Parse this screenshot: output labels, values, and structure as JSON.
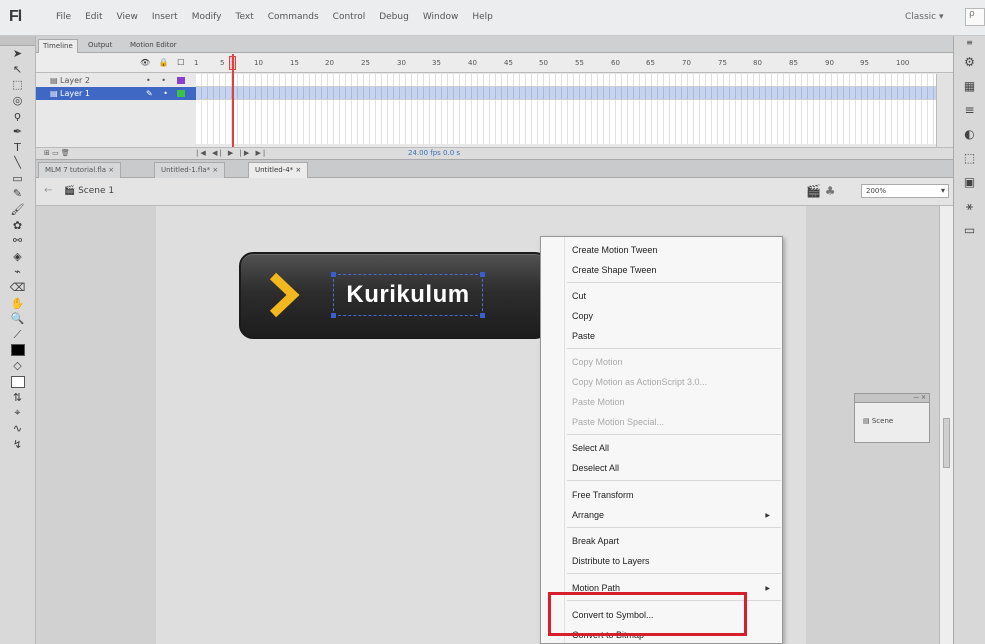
{
  "app": {
    "logo": "Fl",
    "menu": [
      "File",
      "Edit",
      "View",
      "Insert",
      "Modify",
      "Text",
      "Commands",
      "Control",
      "Debug",
      "Window",
      "Help"
    ],
    "workspace": "Classic",
    "search_placeholder": "ρ"
  },
  "timeline": {
    "tabs": [
      "Timeline",
      "Output",
      "Motion Editor"
    ],
    "header_icons": "👁 🔒 ☐",
    "ruler": [
      "1",
      "5",
      "10",
      "15",
      "20",
      "25",
      "30",
      "35",
      "40",
      "45",
      "50",
      "55",
      "60",
      "65",
      "70",
      "75",
      "80",
      "85",
      "90",
      "95",
      "100"
    ],
    "layers": [
      {
        "name": "Layer 2",
        "selected": false,
        "color": "#8a3fd1"
      },
      {
        "name": "Layer 1",
        "selected": true,
        "color": "#3cc24a"
      }
    ],
    "controls": "|◀ ◀| ▶ |▶ ▶|",
    "info": "24.00 fps   0.0 s"
  },
  "doc_tabs": [
    "MLM 7 tutorial.fla",
    "Untitled-1.fla*",
    "Untitled-4*"
  ],
  "editbar": {
    "back": "←",
    "scene": "Scene 1",
    "zoom": "200%"
  },
  "stage": {
    "button_text": "Kurikulum"
  },
  "mini_panel": {
    "label": "Scene"
  },
  "context_menu": {
    "items": [
      {
        "label": "Create Motion Tween",
        "disabled": false
      },
      {
        "label": "Create Shape Tween",
        "disabled": false
      },
      {
        "label": "Cut",
        "disabled": false
      },
      {
        "label": "Copy",
        "disabled": false
      },
      {
        "label": "Paste",
        "disabled": false
      },
      {
        "label": "Copy Motion",
        "disabled": true
      },
      {
        "label": "Copy Motion as ActionScript 3.0...",
        "disabled": true
      },
      {
        "label": "Paste Motion",
        "disabled": true
      },
      {
        "label": "Paste Motion Special...",
        "disabled": true
      },
      {
        "label": "Select All",
        "disabled": false
      },
      {
        "label": "Deselect All",
        "disabled": false
      },
      {
        "label": "Free Transform",
        "disabled": false
      },
      {
        "label": "Arrange",
        "disabled": false
      },
      {
        "label": "Break Apart",
        "disabled": false
      },
      {
        "label": "Distribute to Layers",
        "disabled": false
      },
      {
        "label": "Motion Path",
        "disabled": false
      },
      {
        "label": "Convert to Symbol...",
        "disabled": false
      },
      {
        "label": "Convert to Bitmap",
        "disabled": false
      }
    ],
    "submenu_arrow": "▶"
  },
  "colors": {
    "highlight": "#d81e2a",
    "selection": "#3f68c4",
    "chevron": "#f3b81d"
  }
}
